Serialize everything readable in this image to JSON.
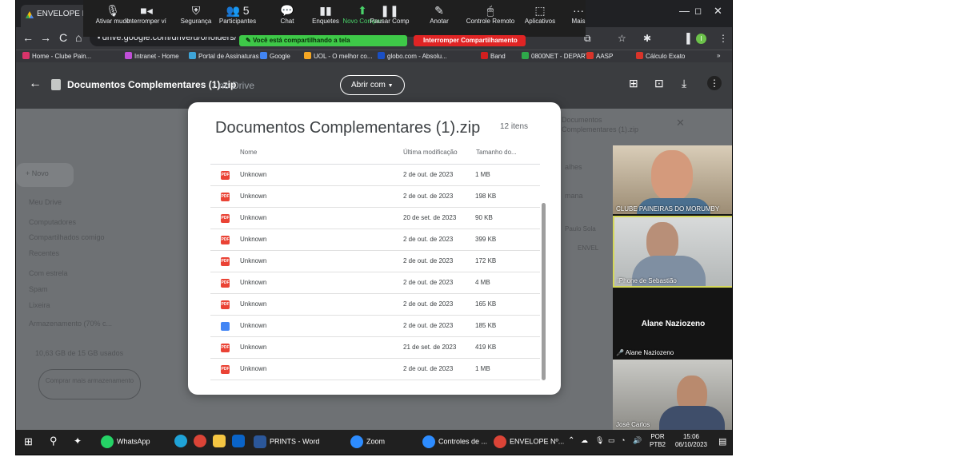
{
  "browser": {
    "tab_title": "ENVELOPE Nº (",
    "minimize_glyph": "—",
    "maximize_glyph": "◻",
    "close_glyph": "✕",
    "url": "drive.google.com/drive/u/0/folders/",
    "profile_initial": "I"
  },
  "zoom_toolbar": {
    "items": [
      {
        "label": "Ativar mudo",
        "icon": "microphone-icon",
        "glyph": "🎙"
      },
      {
        "label": "Interromper ví",
        "icon": "video-icon",
        "glyph": "■◂"
      },
      {
        "label": "Segurança",
        "icon": "shield-icon",
        "glyph": "⛨"
      },
      {
        "label": "Participantes",
        "icon": "participants-icon",
        "glyph": "👥",
        "badge": "5"
      },
      {
        "label": "Chat",
        "icon": "chat-icon",
        "glyph": "💬"
      },
      {
        "label": "Enquetes",
        "icon": "polls-icon",
        "glyph": "▮▮"
      },
      {
        "label": "Novo Compar",
        "icon": "share-screen-icon",
        "glyph": "⬆"
      },
      {
        "label": "Pausar Comp",
        "icon": "pause-icon",
        "glyph": "❚❚"
      },
      {
        "label": "Anotar",
        "icon": "annotate-icon",
        "glyph": "✎"
      },
      {
        "label": "Controle Remoto",
        "icon": "remote-control-icon",
        "glyph": "🖱"
      },
      {
        "label": "Aplicativos",
        "icon": "apps-icon",
        "glyph": "⬚"
      },
      {
        "label": "Mais",
        "icon": "more-icon",
        "glyph": "···"
      }
    ],
    "sharing_text": "Você está compartilhando a tela",
    "stop_sharing_label": "Interromper Compartilhamento"
  },
  "bookmarks": [
    {
      "label": "Home - Clube Pain...",
      "color": "#d8346a"
    },
    {
      "label": "Intranet - Home",
      "color": "#c04fd8"
    },
    {
      "label": "Portal de Assinaturas",
      "color": "#3ea4d8"
    },
    {
      "label": "Google",
      "color": "#4285f4"
    },
    {
      "label": "UOL - O melhor co...",
      "color": "#f5a623"
    },
    {
      "label": "globo.com - Absolu...",
      "color": "#1a4fc4"
    },
    {
      "label": "Band",
      "color": "#d21f1f"
    },
    {
      "label": "0800NET - DEPART...",
      "color": "#2ea84a"
    },
    {
      "label": "AASP",
      "color": "#d8342a"
    },
    {
      "label": "Cálculo Exato",
      "color": "#d8342a"
    }
  ],
  "bookmarks_more": "»",
  "drive": {
    "title": "Documentos Complementares (1).zip",
    "ghost_text": "r no Drive",
    "open_with": "Abrir com",
    "new_button": "Novo",
    "sidebar": [
      "Meu Drive",
      "Computadores",
      "Compartilhados comigo",
      "Recentes",
      "Com estrela",
      "Spam",
      "Lixeira",
      "Armazenamento (70% c..."
    ],
    "storage": "10,63 GB de 15 GB usados",
    "buy_storage": "Comprar mais armazenamento",
    "details_panel": {
      "title": "Documentos Complementares (1).zip",
      "lines": [
        "alhes",
        "mana",
        "Paulo Sola",
        "ENVEL"
      ]
    }
  },
  "dialog": {
    "title": "Documentos Complementares (1).zip",
    "count": "12 itens",
    "columns": {
      "name": "Nome",
      "modified": "Última modificação",
      "size": "Tamanho do..."
    },
    "rows": [
      {
        "icon": "pdf",
        "name": "Unknown",
        "modified": "2 de out. de 2023",
        "size": "1 MB"
      },
      {
        "icon": "pdf",
        "name": "Unknown",
        "modified": "2 de out. de 2023",
        "size": "198 KB"
      },
      {
        "icon": "pdf",
        "name": "Unknown",
        "modified": "20 de set. de 2023",
        "size": "90 KB"
      },
      {
        "icon": "pdf",
        "name": "Unknown",
        "modified": "2 de out. de 2023",
        "size": "399 KB"
      },
      {
        "icon": "pdf",
        "name": "Unknown",
        "modified": "2 de out. de 2023",
        "size": "172 KB"
      },
      {
        "icon": "pdf",
        "name": "Unknown",
        "modified": "2 de out. de 2023",
        "size": "4 MB"
      },
      {
        "icon": "pdf",
        "name": "Unknown",
        "modified": "2 de out. de 2023",
        "size": "165 KB"
      },
      {
        "icon": "doc",
        "name": "Unknown",
        "modified": "2 de out. de 2023",
        "size": "185 KB"
      },
      {
        "icon": "pdf",
        "name": "Unknown",
        "modified": "21 de set. de 2023",
        "size": "419 KB"
      },
      {
        "icon": "pdf",
        "name": "Unknown",
        "modified": "2 de out. de 2023",
        "size": "1 MB"
      }
    ]
  },
  "video_panel": {
    "participants": [
      {
        "name": "CLUBE PAINEIRAS DO MORUMBY",
        "type": "video"
      },
      {
        "name": "iPhone de Sebastião",
        "type": "video"
      },
      {
        "name": "Alane Naziozeno",
        "type": "name-only",
        "display": "Alane Naziozeno",
        "muted": true
      },
      {
        "name": "José Carlos",
        "type": "video"
      }
    ]
  },
  "taskbar": {
    "items": [
      {
        "label": "WhatsApp",
        "icon": "whatsapp-icon",
        "color": "#25d366"
      },
      {
        "label": "PRINTS - Word",
        "icon": "word-icon",
        "color": "#2b579a"
      },
      {
        "label": "Zoom",
        "icon": "zoom-icon",
        "color": "#2d8cff"
      },
      {
        "label": "Controles de ...",
        "icon": "zoom-controls-icon",
        "color": "#2d8cff"
      },
      {
        "label": "ENVELOPE Nº...",
        "icon": "chrome-icon",
        "color": "#db4437"
      }
    ],
    "lang_top": "POR",
    "lang_bottom": "PTB2",
    "time": "15:06",
    "date": "06/10/2023"
  }
}
